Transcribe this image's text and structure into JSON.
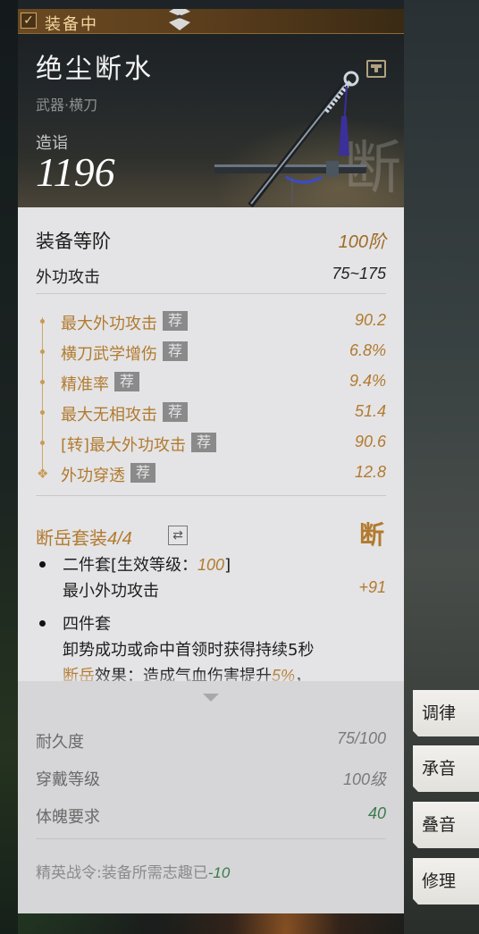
{
  "status_badge": {
    "label": "装备中"
  },
  "item": {
    "name": "绝尘断水",
    "type": "武器·横刀",
    "score_label": "造诣",
    "score": "1196"
  },
  "grade": {
    "label": "装备等阶",
    "value": "100阶"
  },
  "base_attack": {
    "label": "外功攻击",
    "value": "75~175"
  },
  "stats": [
    {
      "label": "最大外功攻击",
      "tag": "荐",
      "value": "90.2"
    },
    {
      "label": "横刀武学增伤",
      "tag": "荐",
      "value": "6.8%"
    },
    {
      "label": "精准率",
      "tag": "荐",
      "value": "9.4%"
    },
    {
      "label": "最大无相攻击",
      "tag": "荐",
      "value": "51.4"
    },
    {
      "label": "[转]最大外功攻击",
      "tag": "荐",
      "value": "90.6"
    },
    {
      "label": "外功穿透",
      "tag": "荐",
      "value": "12.8"
    }
  ],
  "set": {
    "name": "断岳套装",
    "count": "4/4",
    "two_piece_prefix": "二件套[生效等级：",
    "two_piece_level": "100",
    "two_piece_suffix": "]",
    "two_piece_stat": "最小外功攻击",
    "two_piece_value": "+91",
    "four_piece_title": "四件套",
    "four_piece_line1": "卸势成功或命中首领时获得持续5秒",
    "four_piece_effect_name": "断岳",
    "four_piece_line2a": "效果：造成气血伤害提升",
    "four_piece_line2_value": "5%",
    "four_piece_line2b": "，"
  },
  "durability": {
    "label": "耐久度",
    "value": "75/100"
  },
  "wear_level": {
    "label": "穿戴等级",
    "value": "100级"
  },
  "constitution": {
    "label": "体魄要求",
    "value": "40"
  },
  "elite_order": {
    "text": "精英战令:装备所需志趣已",
    "value": "-10"
  },
  "side_buttons": [
    {
      "label": "调律"
    },
    {
      "label": "承音"
    },
    {
      "label": "叠音"
    },
    {
      "label": "修理"
    }
  ],
  "colors": {
    "accent_gold": "#b27a2e",
    "positive_green": "#3a7a4a",
    "panel_bg": "#e4e4e6"
  }
}
